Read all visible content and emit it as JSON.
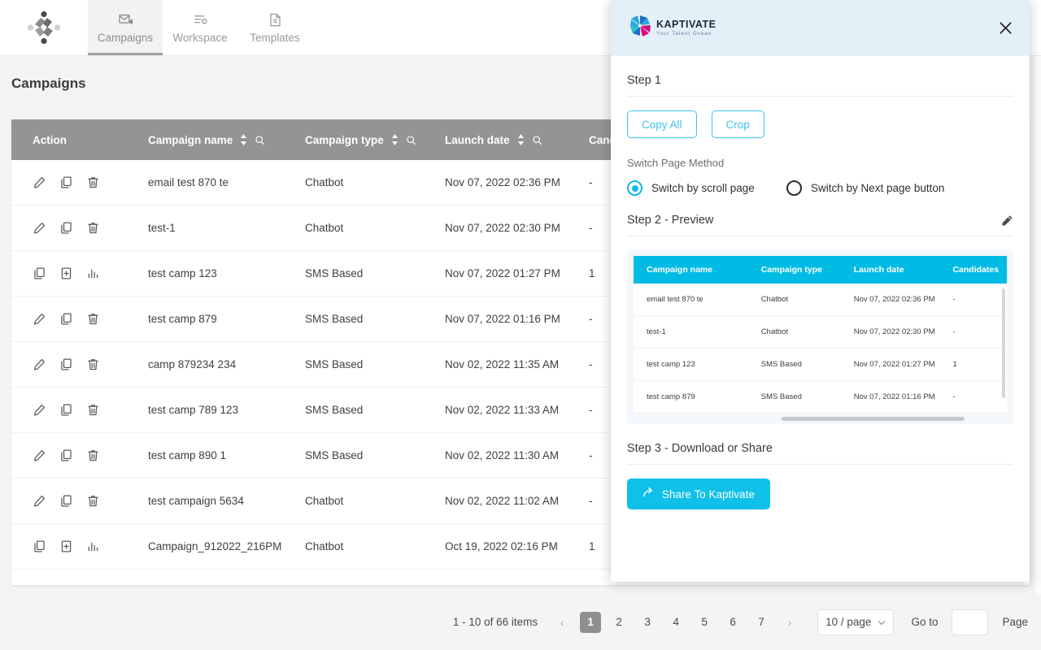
{
  "topnav": {
    "logo_name": "company-logo",
    "tabs": [
      {
        "label": "Campaigns",
        "icon": "campaign-envelope-icon",
        "active": true
      },
      {
        "label": "Workspace",
        "icon": "workspace-settings-icon",
        "active": false
      },
      {
        "label": "Templates",
        "icon": "template-document-icon",
        "active": false
      }
    ]
  },
  "page": {
    "title": "Campaigns"
  },
  "table": {
    "columns": [
      {
        "label": "Action",
        "sortable": false,
        "searchable": false
      },
      {
        "label": "Campaign name",
        "sortable": true,
        "searchable": true
      },
      {
        "label": "Campaign type",
        "sortable": true,
        "searchable": true
      },
      {
        "label": "Launch date",
        "sortable": true,
        "searchable": true
      },
      {
        "label": "Candidate",
        "sortable": false,
        "searchable": false
      }
    ],
    "rows": [
      {
        "actions": [
          "edit-icon",
          "copy-icon",
          "delete-icon"
        ],
        "name": "email test 870 te",
        "type": "Chatbot",
        "date": "Nov 07, 2022 02:36 PM",
        "candidates": "-"
      },
      {
        "actions": [
          "edit-icon",
          "copy-icon",
          "delete-icon"
        ],
        "name": "test-1",
        "type": "Chatbot",
        "date": "Nov 07, 2022 02:30 PM",
        "candidates": "-"
      },
      {
        "actions": [
          "copy-icon",
          "add-box-icon",
          "analytics-icon"
        ],
        "name": "test camp 123",
        "type": "SMS Based",
        "date": "Nov 07, 2022 01:27 PM",
        "candidates": "1"
      },
      {
        "actions": [
          "edit-icon",
          "copy-icon",
          "delete-icon"
        ],
        "name": "test camp 879",
        "type": "SMS Based",
        "date": "Nov 07, 2022 01:16 PM",
        "candidates": "-"
      },
      {
        "actions": [
          "edit-icon",
          "copy-icon",
          "delete-icon"
        ],
        "name": "camp 879234 234",
        "type": "SMS Based",
        "date": "Nov 02, 2022 11:35 AM",
        "candidates": "-"
      },
      {
        "actions": [
          "edit-icon",
          "copy-icon",
          "delete-icon"
        ],
        "name": "test camp 789 123",
        "type": "SMS Based",
        "date": "Nov 02, 2022 11:33 AM",
        "candidates": "-"
      },
      {
        "actions": [
          "edit-icon",
          "copy-icon",
          "delete-icon"
        ],
        "name": "test camp 890 1",
        "type": "SMS Based",
        "date": "Nov 02, 2022 11:30 AM",
        "candidates": "-"
      },
      {
        "actions": [
          "edit-icon",
          "copy-icon",
          "delete-icon"
        ],
        "name": "test campaign 5634",
        "type": "Chatbot",
        "date": "Nov 02, 2022 11:02 AM",
        "candidates": "-"
      },
      {
        "actions": [
          "copy-icon",
          "add-box-icon",
          "analytics-icon"
        ],
        "name": "Campaign_912022_216PM",
        "type": "Chatbot",
        "date": "Oct 19, 2022 02:16 PM",
        "candidates": "1"
      }
    ]
  },
  "pagination": {
    "info": "1 - 10 of 66 items",
    "prev": "‹",
    "next": "›",
    "pages": [
      "1",
      "2",
      "3",
      "4",
      "5",
      "6",
      "7"
    ],
    "active_page": "1",
    "page_size": "10 / page",
    "goto_label": "Go to",
    "goto_value": "",
    "page_label": "Page"
  },
  "panel": {
    "logo": {
      "name": "KAPTIVATE",
      "tagline": "Your Talent Ocean"
    },
    "close_icon": "close-icon",
    "step1": {
      "title": "Step 1",
      "copy_all_label": "Copy All",
      "crop_label": "Crop",
      "switch_method_label": "Switch Page Method",
      "radios": [
        {
          "label": "Switch by scroll page",
          "selected": true
        },
        {
          "label": "Switch by Next page button",
          "selected": false
        }
      ]
    },
    "step2": {
      "title": "Step 2 - Preview",
      "edit_icon": "edit-pencil-icon",
      "columns": [
        "Campaign name",
        "Campaign type",
        "Launch date",
        "Candidates"
      ],
      "rows": [
        {
          "name": "email test 870 te",
          "type": "Chatbot",
          "date": "Nov 07, 2022 02:36 PM",
          "candidates": "-"
        },
        {
          "name": "test-1",
          "type": "Chatbot",
          "date": "Nov 07, 2022 02:30 PM",
          "candidates": "-"
        },
        {
          "name": "test camp 123",
          "type": "SMS Based",
          "date": "Nov 07, 2022 01:27 PM",
          "candidates": "1"
        },
        {
          "name": "test camp 879",
          "type": "SMS Based",
          "date": "Nov 07, 2022 01:16 PM",
          "candidates": "-"
        }
      ]
    },
    "step3": {
      "title": "Step 3 - Download or Share",
      "share_label": "Share To Kaptivate",
      "share_icon": "share-arrow-icon"
    }
  },
  "colors": {
    "accent_cyan": "#00bce4",
    "outline_cyan": "#3fc3ef",
    "header_gray": "#949494",
    "panel_header_blue": "#e4f0f7"
  }
}
